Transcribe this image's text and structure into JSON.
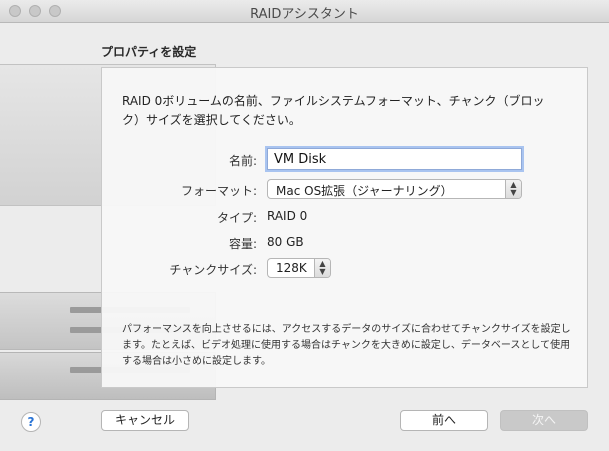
{
  "window": {
    "title": "RAIDアシスタント"
  },
  "section_title": "プロパティを設定",
  "description": "RAID 0ボリュームの名前、ファイルシステムフォーマット、チャンク（ブロック）サイズを選択してください。",
  "form": {
    "name_label": "名前:",
    "name_value": "VM Disk",
    "format_label": "フォーマット:",
    "format_value": "Mac OS拡張（ジャーナリング）",
    "type_label": "タイプ:",
    "type_value": "RAID 0",
    "capacity_label": "容量:",
    "capacity_value": "80 GB",
    "chunk_label": "チャンクサイズ:",
    "chunk_value": "128K"
  },
  "note": "パフォーマンスを向上させるには、アクセスするデータのサイズに合わせてチャンクサイズを設定します。たとえば、ビデオ処理に使用する場合はチャンクを大きめに設定し、データベースとして使用する場合は小さめに設定します。",
  "buttons": {
    "help": "?",
    "cancel": "キャンセル",
    "back": "前へ",
    "next": "次へ"
  },
  "icons": {
    "popup_arrows": "up-down-chevron",
    "help": "question-mark"
  },
  "colors": {
    "focus_ring": "#a9c4f0",
    "help_blue": "#2a74d6",
    "disabled_button": "#c9c9c9"
  }
}
